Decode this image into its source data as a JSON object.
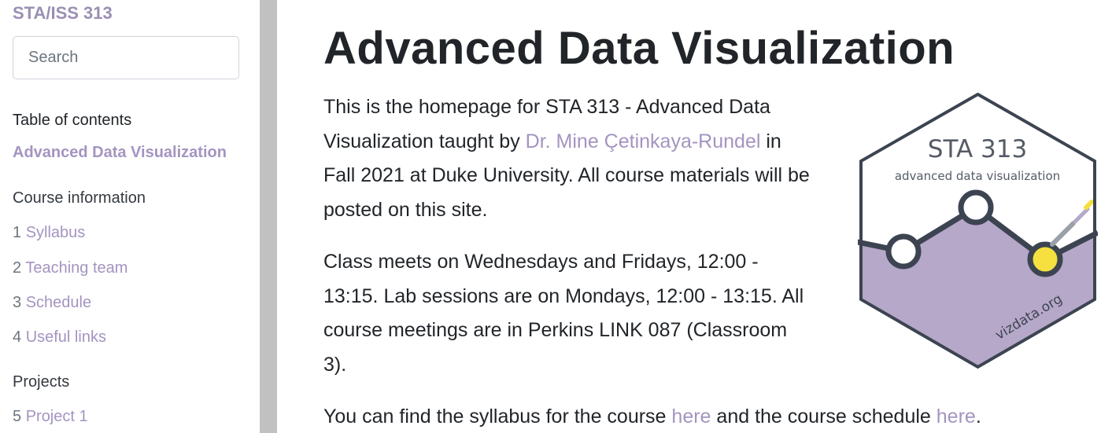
{
  "sidebar": {
    "site_title": "STA/ISS 313",
    "search_placeholder": "Search",
    "toc_heading": "Table of contents",
    "toc_active": "Advanced Data Visualization",
    "sections": [
      {
        "label": "Course information",
        "items": [
          {
            "num": "1",
            "label": "Syllabus"
          },
          {
            "num": "2",
            "label": "Teaching team"
          },
          {
            "num": "3",
            "label": "Schedule"
          },
          {
            "num": "4",
            "label": "Useful links"
          }
        ]
      },
      {
        "label": "Projects",
        "items": [
          {
            "num": "5",
            "label": "Project 1"
          }
        ]
      }
    ]
  },
  "main": {
    "title": "Advanced Data Visualization",
    "p1": {
      "before": "This is the homepage for STA 313 - Advanced Data Visualization taught by ",
      "link": "Dr. Mine Çetinkaya-Rundel",
      "after": " in Fall 2021 at Duke University. All course materials will be posted on this site."
    },
    "p2": "Class meets on Wednesdays and Fridays, 12:00 - 13:15. Lab sessions are on Mondays, 12:00 - 13:15. All course meetings are in Perkins LINK 087 (Classroom 3).",
    "p3": {
      "before": "You can find the syllabus for the course ",
      "link1": "here",
      "middle": " and the course schedule ",
      "link2": "here",
      "after": "."
    },
    "logo": {
      "title": "STA 313",
      "subtitle": "advanced data visualization",
      "url": "vizdata.org",
      "fill_color": "#b6a8c9",
      "accent_color": "#f5e03f",
      "stroke_color": "#3d4451"
    }
  }
}
